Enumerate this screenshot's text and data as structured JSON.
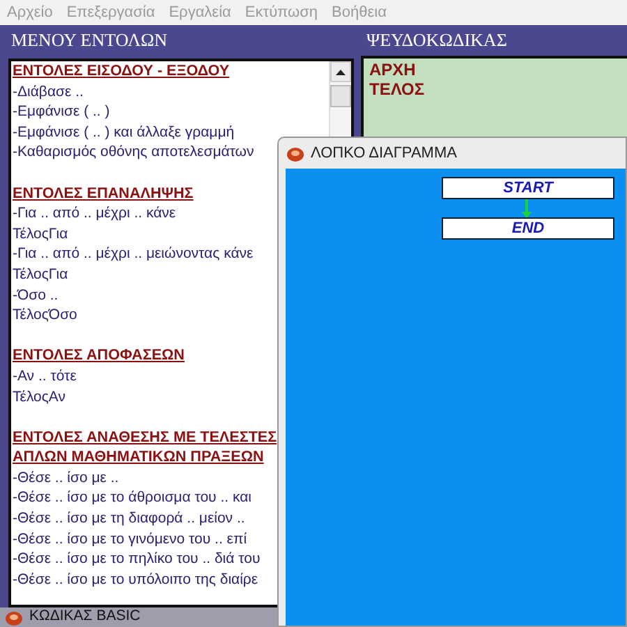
{
  "menu_bar": [
    "Αρχείο",
    "Επεξεργασία",
    "Εργαλεία",
    "Εκτύπωση",
    "Βοήθεια"
  ],
  "commands_panel": {
    "title": "ΜΕΝΟΥ ΕΝΤΟΛΩΝ",
    "items": [
      {
        "kind": "heading",
        "text": "ΕΝΤΟΛΕΣ ΕΙΣΟΔΟΥ - ΕΞΟΔΟΥ"
      },
      {
        "kind": "item",
        "text": "-Διάβασε .."
      },
      {
        "kind": "item",
        "text": "-Εμφάνισε ( .. )"
      },
      {
        "kind": "item",
        "text": "-Εμφάνισε ( .. ) και άλλαξε γραμμή"
      },
      {
        "kind": "item",
        "text": "-Καθαρισμός οθόνης αποτελεσμάτων"
      },
      {
        "kind": "gap"
      },
      {
        "kind": "heading",
        "text": "ΕΝΤΟΛΕΣ ΕΠΑΝΑΛΗΨΗΣ"
      },
      {
        "kind": "item",
        "text": "-Για .. από .. μέχρι .. κάνε"
      },
      {
        "kind": "item",
        "text": "ΤέλοςΓια"
      },
      {
        "kind": "item",
        "text": "-Για .. από .. μέχρι .. μειώνοντας κάνε"
      },
      {
        "kind": "item",
        "text": "ΤέλοςΓια"
      },
      {
        "kind": "item",
        "text": "-Όσο .."
      },
      {
        "kind": "item",
        "text": "ΤέλοςΌσο"
      },
      {
        "kind": "gap"
      },
      {
        "kind": "heading",
        "text": "ΕΝΤΟΛΕΣ ΑΠΟΦΑΣΕΩΝ"
      },
      {
        "kind": "item",
        "text": "-Αν .. τότε"
      },
      {
        "kind": "item",
        "text": "ΤέλοςΑν"
      },
      {
        "kind": "gap"
      },
      {
        "kind": "heading",
        "text": "ΕΝΤΟΛΕΣ ΑΝΑΘΕΣΗΣ ΜΕ ΤΕΛΕΣΤΕΣ"
      },
      {
        "kind": "heading",
        "text": "ΑΠΛΩΝ ΜΑΘΗΜΑΤΙΚΩΝ ΠΡΑΞΕΩΝ"
      },
      {
        "kind": "item",
        "text": "-Θέσε .. ίσο με .."
      },
      {
        "kind": "item",
        "text": "-Θέσε .. ίσο με το άθροισμα του .. και"
      },
      {
        "kind": "item",
        "text": "-Θέσε .. ίσο με τη διαφορά .. μείον .."
      },
      {
        "kind": "item",
        "text": "-Θέσε .. ίσο με το γινόμενο του .. επί"
      },
      {
        "kind": "item",
        "text": "-Θέσε .. ίσο με το πηλίκο του .. διά του"
      },
      {
        "kind": "item",
        "text": "-Θέσε .. ίσο με το υπόλοιπο της διαίρε"
      }
    ]
  },
  "pseudocode_panel": {
    "title": "ΨΕΥΔΟΚΩΔΙΚΑΣ",
    "lines": [
      "ΑΡΧΗ",
      "ΤΕΛΟΣ"
    ]
  },
  "flowchart_window": {
    "title": "ΛΟΠΚΟ ΔΙΑΓΡΑΜΜΑ",
    "nodes": [
      "START",
      "END"
    ]
  },
  "minimized_window": {
    "title": "ΚΩΔΙΚΑΣ BASIC"
  }
}
